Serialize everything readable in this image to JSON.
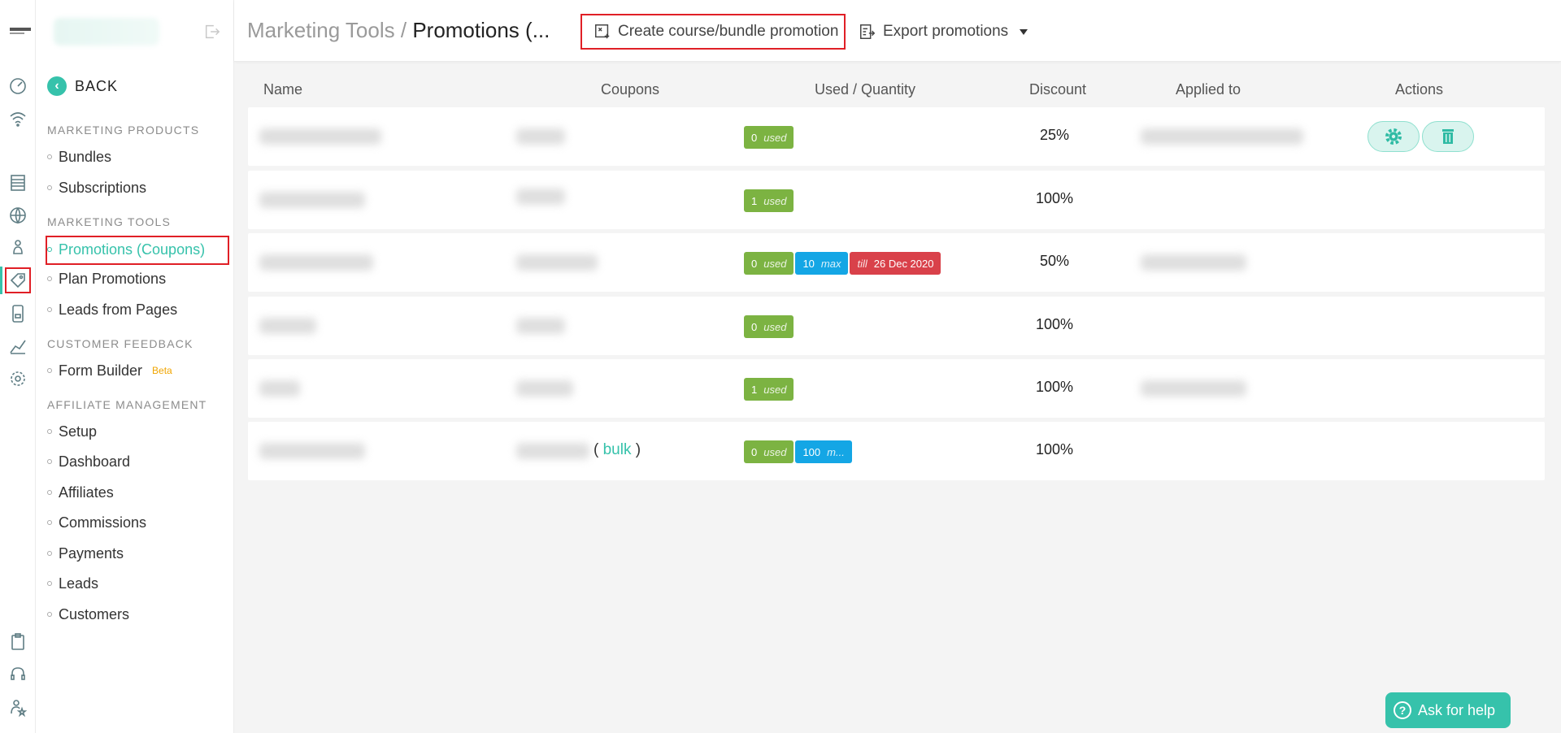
{
  "sidebar": {
    "back_label": "BACK",
    "sections": [
      {
        "title": "MARKETING PRODUCTS"
      },
      {
        "title": "MARKETING TOOLS"
      },
      {
        "title": "CUSTOMER FEEDBACK"
      },
      {
        "title": "AFFILIATE MANAGEMENT"
      }
    ],
    "items": {
      "bundles": "Bundles",
      "subscriptions": "Subscriptions",
      "promotions": "Promotions (Coupons)",
      "plan_promotions": "Plan Promotions",
      "leads_from_pages": "Leads from Pages",
      "form_builder": "Form Builder",
      "beta": "Beta",
      "setup": "Setup",
      "dashboard": "Dashboard",
      "affiliates": "Affiliates",
      "commissions": "Commissions",
      "payments": "Payments",
      "leads": "Leads",
      "customers": "Customers"
    }
  },
  "header": {
    "crumb_parent": "Marketing Tools",
    "crumb_sep": "/",
    "crumb_current": "Promotions (...",
    "create_label": "Create course/bundle promotion",
    "export_label": "Export promotions"
  },
  "table": {
    "columns": [
      "Name",
      "Coupons",
      "Used / Quantity",
      "Discount",
      "Applied to",
      "Actions"
    ],
    "rows": [
      {
        "used": "0",
        "used_word": "used",
        "discount": "25%"
      },
      {
        "used": "1",
        "used_word": "used",
        "discount": "100%"
      },
      {
        "used": "0",
        "used_word": "used",
        "max": "10",
        "max_word": "max",
        "till_word": "till",
        "till_date": "26 Dec 2020",
        "discount": "50%"
      },
      {
        "used": "0",
        "used_word": "used",
        "discount": "100%"
      },
      {
        "used": "1",
        "used_word": "used",
        "discount": "100%"
      },
      {
        "used": "0",
        "used_word": "used",
        "max": "100",
        "max_word": "m...",
        "discount": "100%",
        "bulk_open": "(",
        "bulk": "bulk",
        "bulk_close": ")"
      }
    ]
  },
  "help": {
    "label": "Ask for help"
  },
  "colors": {
    "accent": "#36c2ab",
    "highlight": "#e01f26",
    "used_badge": "#7cb342",
    "max_badge": "#14a6e5",
    "till_badge": "#d9414a"
  }
}
